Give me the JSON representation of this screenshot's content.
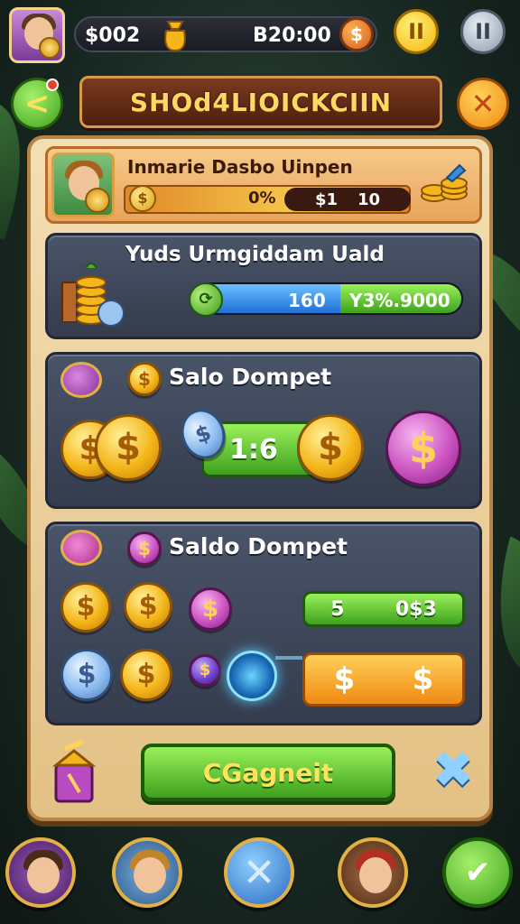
{
  "topbar": {
    "left_amount": "$002",
    "right_amount": "B20:00",
    "right_coin_glyph": "$",
    "pause_glyph": "II",
    "menu_glyph": "II"
  },
  "header": {
    "title": "SHOd4LIOICKCIIN",
    "back_glyph": "<",
    "close_glyph": "✕"
  },
  "profile": {
    "name": "Inmarie Dasbo Uinpen",
    "percent": "0%",
    "cash_label": "$1",
    "cash_value": "10"
  },
  "daily_card": {
    "title": "Yuds Urmgiddam Uald",
    "progress_value": "160",
    "progress_target": "Y3%.9000",
    "progress_fill": 0.55
  },
  "wallet_card_1": {
    "title": "Salo Dompet",
    "exchange_label": "1:6"
  },
  "wallet_card_2": {
    "title": "Saldo Dompet",
    "green_pill_left": "5",
    "green_pill_right": "0$3",
    "orange_coin_1": "$",
    "orange_coin_2": "$"
  },
  "actions": {
    "collect_label": "CGagneit"
  },
  "coin_symbol": "$",
  "colors": {
    "accent_green": "#3ea11e",
    "accent_orange": "#f08a12",
    "panel_bg": "#f3dfb3",
    "card_bg": "#434c60",
    "title_text": "#ffd763"
  },
  "icons": {
    "back": "chevron-left-icon",
    "close": "close-icon",
    "pause": "pause-icon",
    "menu": "menu-icon",
    "nav_x": "close-icon",
    "nav_ok": "check-icon"
  }
}
